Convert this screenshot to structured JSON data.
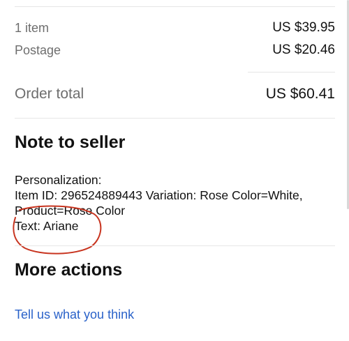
{
  "summary": {
    "items_label": "1 item",
    "items_value": "US $39.95",
    "postage_label": "Postage",
    "postage_value": "US $20.46",
    "total_label": "Order total",
    "total_value": "US $60.41"
  },
  "note": {
    "heading": "Note to seller",
    "lines": [
      "Personalization:",
      "Item ID: 296524889443 Variation: Rose Color=White,",
      "Product=Rose Color",
      "Text: Ariane"
    ]
  },
  "more_actions": {
    "heading": "More actions",
    "feedback_link": "Tell us what you think"
  },
  "colors": {
    "link": "#2a62c9",
    "annotation_circle": "#c8341f"
  }
}
